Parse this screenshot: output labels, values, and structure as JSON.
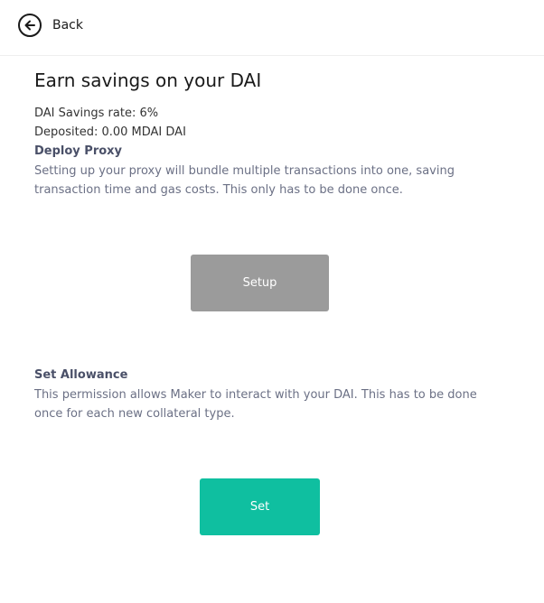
{
  "header": {
    "back_label": "Back"
  },
  "main": {
    "title": "Earn savings on your DAI",
    "savings_rate": "DAI Savings rate: 6%",
    "deposited": "Deposited: 0.00 MDAI DAI",
    "proxy": {
      "heading": "Deploy Proxy",
      "description": "Setting up your proxy will bundle multiple transactions into one, saving transaction time and gas costs. This only has to be done once.",
      "button_label": "Setup"
    },
    "allowance": {
      "heading": "Set Allowance",
      "description": "This permission allows Maker to interact with your DAI. This has to be done once for each new collateral type.",
      "button_label": "Set"
    }
  },
  "colors": {
    "setup_button": "#9b9b9b",
    "set_button": "#0fbfa0",
    "heading": "#4a5068"
  },
  "icons": {
    "back": "arrow-left-circle-icon"
  }
}
